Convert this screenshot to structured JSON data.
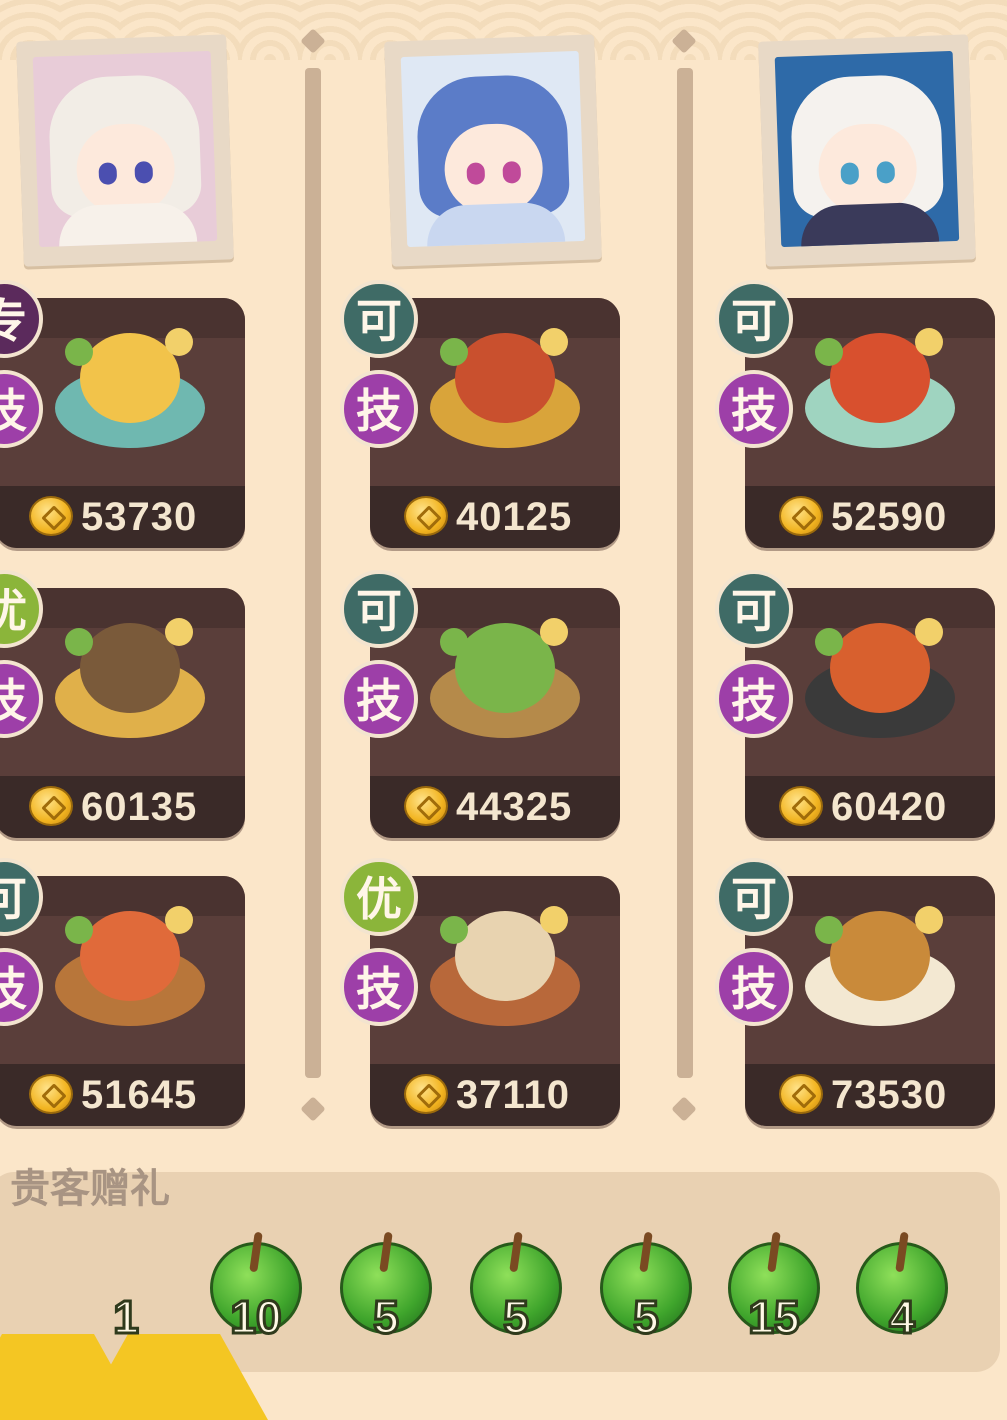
{
  "guests": [
    {
      "portrait_name": "guest-portrait-hooded-girl",
      "palette": {
        "hair": "#f2ede6",
        "body": "#f7f1ea",
        "eye": "#4b4fb0",
        "bg": "#e8ccd8"
      },
      "dishes": [
        {
          "badge_top": "专",
          "badge_bottom": "技",
          "price": "53730",
          "plate": "#6fb8b0",
          "food": "#f2c34a"
        },
        {
          "badge_top": "优",
          "badge_bottom": "技",
          "price": "60135",
          "plate": "#e0b04a",
          "food": "#7a5a3a"
        },
        {
          "badge_top": "可",
          "badge_bottom": "技",
          "price": "51645",
          "plate": "#b8763a",
          "food": "#e06a3a"
        }
      ]
    },
    {
      "portrait_name": "guest-portrait-blue-hair",
      "palette": {
        "hair": "#5b7cc8",
        "body": "#c9d7f0",
        "eye": "#c04a9a",
        "bg": "#dfe8f4"
      },
      "dishes": [
        {
          "badge_top": "可",
          "badge_bottom": "技",
          "price": "40125",
          "plate": "#d9a43a",
          "food": "#c9502e"
        },
        {
          "badge_top": "可",
          "badge_bottom": "技",
          "price": "44325",
          "plate": "#b58a4a",
          "food": "#7ab54a"
        },
        {
          "badge_top": "优",
          "badge_bottom": "技",
          "price": "37110",
          "plate": "#b8683a",
          "food": "#e8d3b0"
        }
      ]
    },
    {
      "portrait_name": "guest-portrait-white-hair",
      "palette": {
        "hair": "#f5f2ee",
        "body": "#3a3a5a",
        "eye": "#4aa0c8",
        "bg": "#2e6aa8"
      },
      "dishes": [
        {
          "badge_top": "可",
          "badge_bottom": "技",
          "price": "52590",
          "plate": "#9fd4c0",
          "food": "#d8502e"
        },
        {
          "badge_top": "可",
          "badge_bottom": "技",
          "price": "60420",
          "plate": "#3a3a3a",
          "food": "#d8602e"
        },
        {
          "badge_top": "可",
          "badge_bottom": "技",
          "price": "73530",
          "plate": "#f3e8d2",
          "food": "#c98a3a"
        }
      ]
    }
  ],
  "gift_section": {
    "title": "贵客赠礼",
    "items": [
      {
        "type": "triangle-token",
        "count": ""
      },
      {
        "type": "triangle-token",
        "count": "1"
      },
      {
        "type": "green-apple",
        "count": "10"
      },
      {
        "type": "green-apple",
        "count": "5"
      },
      {
        "type": "green-apple",
        "count": "5"
      },
      {
        "type": "green-apple",
        "count": "5"
      },
      {
        "type": "green-apple",
        "count": "15"
      },
      {
        "type": "green-apple",
        "count": "4"
      }
    ]
  },
  "colors": {
    "background": "#fbe6c9",
    "card": "#5a3e3a",
    "price_text": "#f4e6cf",
    "badge_green": "#3f6b66",
    "badge_lime": "#8bb53a",
    "badge_purple": "#9d3fa8"
  }
}
